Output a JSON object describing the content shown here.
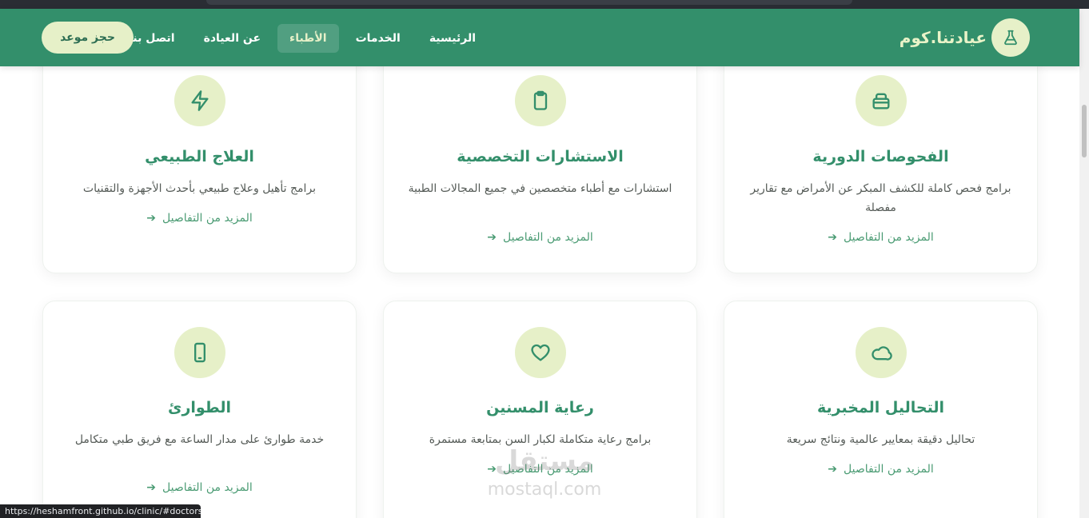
{
  "header": {
    "brand": "عيادتنا.كوم",
    "brand_icon": "flask-icon",
    "nav": [
      {
        "label": "الرئيسية",
        "active": false
      },
      {
        "label": "الخدمات",
        "active": false
      },
      {
        "label": "الأطباء",
        "active": true
      },
      {
        "label": "عن العيادة",
        "active": false
      },
      {
        "label": "اتصل بنا",
        "active": false
      }
    ],
    "cta": "حجز موعد"
  },
  "services": [
    {
      "icon": "box-icon",
      "title": "الفحوصات الدورية",
      "desc": "برامج فحص كاملة للكشف المبكر عن الأمراض مع تقارير مفصلة",
      "more": "المزيد من التفاصيل"
    },
    {
      "icon": "clipboard-icon",
      "title": "الاستشارات التخصصية",
      "desc": "استشارات مع أطباء متخصصين في جميع المجالات الطبية",
      "more": "المزيد من التفاصيل"
    },
    {
      "icon": "lightning-icon",
      "title": "العلاج الطبيعي",
      "desc": "برامج تأهيل وعلاج طبيعي بأحدث الأجهزة والتقنيات",
      "more": "المزيد من التفاصيل"
    },
    {
      "icon": "cloud-icon",
      "title": "التحاليل المخبرية",
      "desc": "تحاليل دقيقة بمعايير عالمية ونتائج سريعة",
      "more": "المزيد من التفاصيل"
    },
    {
      "icon": "heart-icon",
      "title": "رعاية المسنين",
      "desc": "برامج رعاية متكاملة لكبار السن بمتابعة مستمرة",
      "more": "المزيد من التفاصيل"
    },
    {
      "icon": "phone-icon",
      "title": "الطوارئ",
      "desc": "خدمة طوارئ على مدار الساعة مع فريق طبي متكامل",
      "more": "المزيد من التفاصيل"
    }
  ],
  "watermark": {
    "line1": "مستقل",
    "line2": "mostaql.com"
  },
  "status_url": "https://heshamfront.github.io/clinic/#doctors",
  "colors": {
    "primary": "#338f6b",
    "accent": "#e6f0c8",
    "text": "#555b57"
  }
}
